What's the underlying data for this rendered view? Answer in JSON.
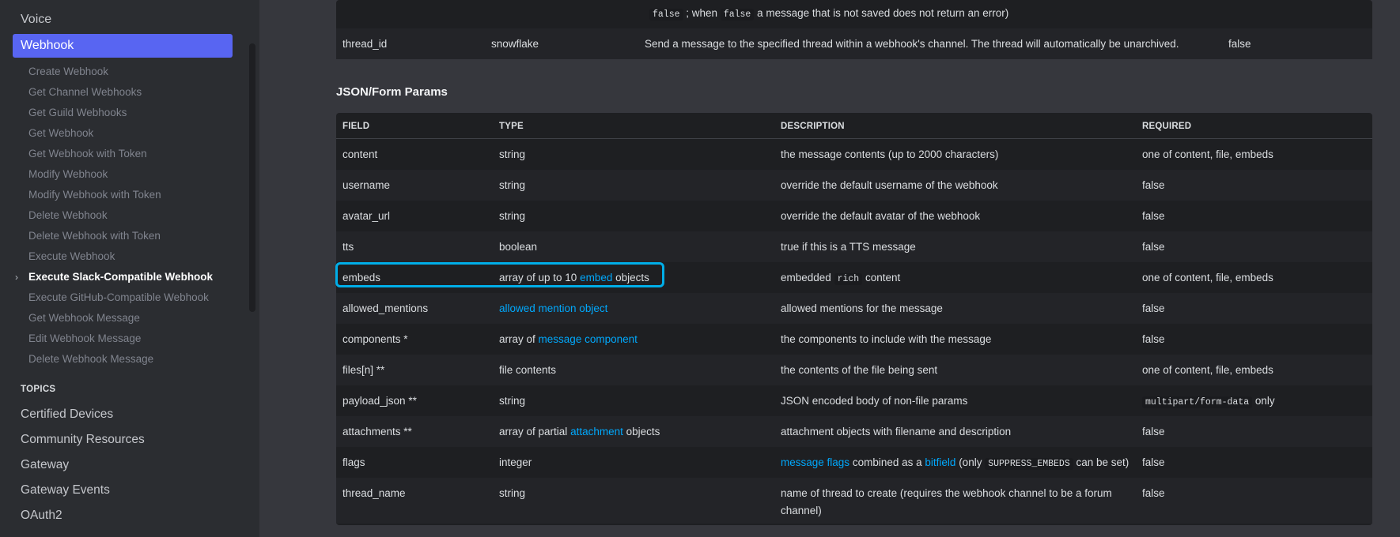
{
  "sidebar": {
    "top_items": [
      "Voice"
    ],
    "active_item": "Webhook",
    "sub_items": [
      {
        "label": "Create Webhook",
        "bold": false
      },
      {
        "label": "Get Channel Webhooks",
        "bold": false
      },
      {
        "label": "Get Guild Webhooks",
        "bold": false
      },
      {
        "label": "Get Webhook",
        "bold": false
      },
      {
        "label": "Get Webhook with Token",
        "bold": false
      },
      {
        "label": "Modify Webhook",
        "bold": false
      },
      {
        "label": "Modify Webhook with Token",
        "bold": false
      },
      {
        "label": "Delete Webhook",
        "bold": false
      },
      {
        "label": "Delete Webhook with Token",
        "bold": false
      },
      {
        "label": "Execute Webhook",
        "bold": false
      },
      {
        "label": "Execute Slack-Compatible Webhook",
        "bold": true
      },
      {
        "label": "Execute GitHub-Compatible Webhook",
        "bold": false
      },
      {
        "label": "Get Webhook Message",
        "bold": false
      },
      {
        "label": "Edit Webhook Message",
        "bold": false
      },
      {
        "label": "Delete Webhook Message",
        "bold": false
      }
    ],
    "chevron": "›",
    "topics_heading": "TOPICS",
    "topics": [
      "Certified Devices",
      "Community Resources",
      "Gateway",
      "Gateway Events",
      "OAuth2"
    ]
  },
  "query_table": {
    "cut_row": {
      "pre": "false",
      "mid": "; when",
      "code": "false",
      "post": "a message that is not saved does not return an error)"
    },
    "thread_row": {
      "field": "thread_id",
      "type": "snowflake",
      "description": "Send a message to the specified thread within a webhook's channel. The thread will automatically be unarchived.",
      "required": "false"
    }
  },
  "json_table": {
    "title": "JSON/Form Params",
    "headers": {
      "field": "FIELD",
      "type": "TYPE",
      "description": "DESCRIPTION",
      "required": "REQUIRED"
    },
    "rows": [
      {
        "field": "content",
        "type": "string",
        "description": "the message contents (up to 2000 characters)",
        "required": "one of content, file, embeds"
      },
      {
        "field": "username",
        "type": "string",
        "description": "override the default username of the webhook",
        "required": "false"
      },
      {
        "field": "avatar_url",
        "type": "string",
        "description": "override the default avatar of the webhook",
        "required": "false"
      },
      {
        "field": "tts",
        "type": "boolean",
        "description": "true if this is a TTS message",
        "required": "false"
      },
      {
        "field": "embeds",
        "type_pre": "array of up to 10",
        "type_link": "embed",
        "type_post": "objects",
        "desc_pre": "embedded",
        "desc_code": "rich",
        "desc_post": "content",
        "required": "one of content, file, embeds"
      },
      {
        "field": "allowed_mentions",
        "type_link": "allowed mention object",
        "description": "allowed mentions for the message",
        "required": "false"
      },
      {
        "field": "components *",
        "type_pre": "array of",
        "type_link": "message component",
        "description": "the components to include with the message",
        "required": "false"
      },
      {
        "field": "files[n] **",
        "type": "file contents",
        "description": "the contents of the file being sent",
        "required": "one of content, file, embeds"
      },
      {
        "field": "payload_json **",
        "type": "string",
        "description": "JSON encoded body of non-file params",
        "required_code": "multipart/form-data",
        "required_post": "only"
      },
      {
        "field": "attachments **",
        "type_pre": "array of partial",
        "type_link": "attachment",
        "type_post": "objects",
        "description": "attachment objects with filename and description",
        "required": "false"
      },
      {
        "field": "flags",
        "type": "integer",
        "desc_link1": "message flags",
        "desc_mid": "combined as a",
        "desc_link2": "bitfield",
        "desc_pre2": "(only",
        "desc_code": "SUPPRESS_EMBEDS",
        "desc_post": "can be set)",
        "required": "false"
      },
      {
        "field": "thread_name",
        "type": "string",
        "description": "name of thread to create (requires the webhook channel to be a forum",
        "description2": "channel)",
        "required": "false"
      }
    ]
  }
}
